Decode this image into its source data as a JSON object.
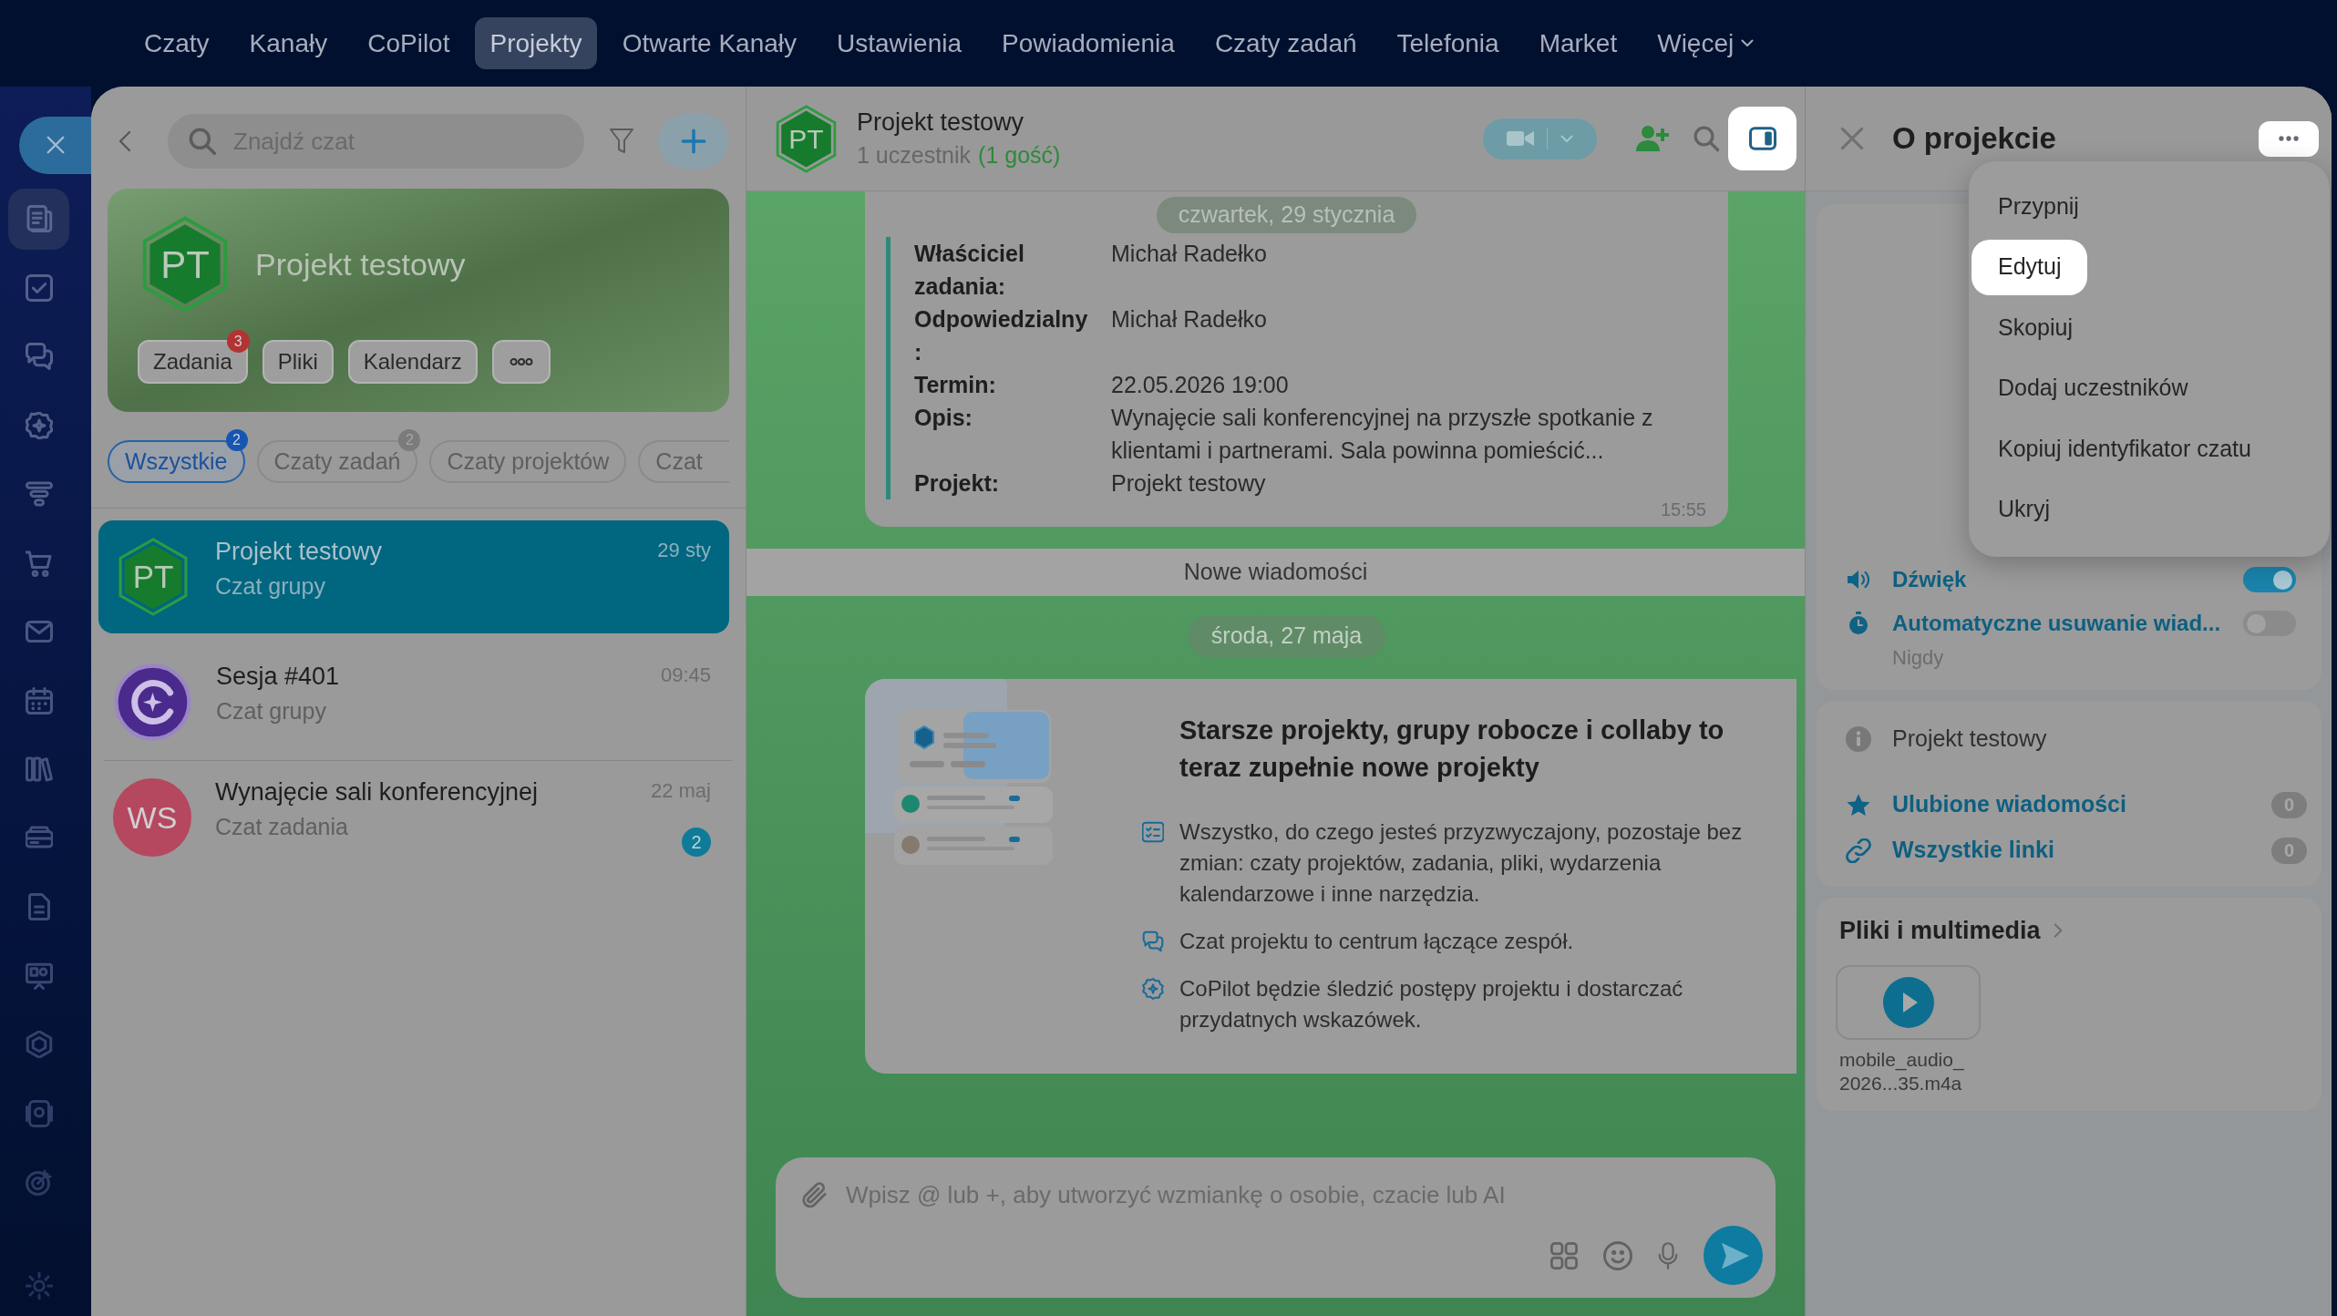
{
  "top_nav": {
    "items": [
      {
        "label": "Czaty",
        "selected": false,
        "kind": "link"
      },
      {
        "label": "Kanały",
        "selected": false,
        "kind": "link"
      },
      {
        "label": "CoPilot",
        "selected": false,
        "kind": "link"
      },
      {
        "label": "Projekty",
        "selected": true,
        "kind": "link"
      },
      {
        "label": "Otwarte Kanały",
        "selected": false,
        "kind": "link"
      },
      {
        "label": "Ustawienia",
        "selected": false,
        "kind": "link"
      },
      {
        "label": "Powiadomienia",
        "selected": false,
        "kind": "link"
      },
      {
        "label": "Czaty zadań",
        "selected": false,
        "kind": "link"
      },
      {
        "label": "Telefonia",
        "selected": false,
        "kind": "link"
      },
      {
        "label": "Market",
        "selected": false,
        "kind": "link"
      },
      {
        "label": "Więcej",
        "selected": false,
        "kind": "menu"
      }
    ]
  },
  "rail": {
    "items": [
      {
        "selected": true
      },
      {
        "selected": false
      },
      {
        "selected": false
      },
      {
        "selected": false
      },
      {
        "selected": false
      },
      {
        "selected": false
      },
      {
        "selected": false
      },
      {
        "selected": false
      },
      {
        "selected": false
      },
      {
        "selected": false
      },
      {
        "selected": false
      },
      {
        "selected": false
      },
      {
        "selected": false
      },
      {
        "selected": false
      },
      {
        "selected": false
      },
      {
        "selected": false
      }
    ]
  },
  "chat_list": {
    "search": {
      "placeholder": "Znajdź czat"
    },
    "project_card": {
      "avatar": "PT",
      "title": "Projekt testowy",
      "buttons": [
        {
          "kind": "text",
          "label": "Zadania",
          "badge": "3"
        },
        {
          "kind": "text",
          "label": "Pliki"
        },
        {
          "kind": "text",
          "label": "Kalendarz"
        },
        {
          "kind": "more"
        }
      ]
    },
    "filters": [
      {
        "label": "Wszystkie",
        "selected": true,
        "badge": "2"
      },
      {
        "label": "Czaty zadań",
        "selected": false,
        "badge": "2"
      },
      {
        "label": "Czaty projektów",
        "selected": false
      },
      {
        "label": "Czat",
        "selected": false
      }
    ],
    "chats": [
      {
        "kind": "project",
        "avatar": "PT",
        "title": "Projekt testowy",
        "subtitle": "Czat grupy",
        "time": "29 sty",
        "selected": true
      },
      {
        "kind": "copilot",
        "title": "Sesja #401",
        "subtitle": "Czat grupy",
        "time": "09:45",
        "selected": false
      },
      {
        "kind": "initials",
        "avatar": "WS",
        "color": "#b5475f",
        "title": "Wynajęcie sali konferencyjnej",
        "subtitle": "Czat zadania",
        "time": "22 maj",
        "unread": "2",
        "selected": false
      }
    ]
  },
  "chat": {
    "header": {
      "avatar": "PT",
      "title": "Projekt testowy",
      "members": "1 uczestnik",
      "guests": "(1 gość)",
      "panel_button": {
        "highlighted": true
      }
    },
    "sticky_date": "czwartek, 29 stycznia",
    "task_message": {
      "fields": [
        {
          "label": "Właściciel zadania:",
          "value": "Michał Radełko"
        },
        {
          "label": "Odpowiedzialny:",
          "value": "Michał Radełko"
        },
        {
          "label": "Termin:",
          "value": "22.05.2026 19:00"
        },
        {
          "label": "Opis:",
          "value": "Wynajęcie sali konferencyjnej na przyszłe spotkanie z klientami i partnerami. Sala powinna pomieścić..."
        },
        {
          "label": "Projekt:",
          "value": "Projekt testowy"
        }
      ],
      "time": "15:55"
    },
    "new_messages": "Nowe wiadomości",
    "date_separator": "środa, 27 maja",
    "promo": {
      "title": "Starsze projekty, grupy robocze i collaby to teraz zupełnie nowe projekty",
      "points": [
        "Wszystko, do czego jesteś przyzwyczajony, pozostaje bez zmian: czaty projektów, zadania, pliki, wydarzenia kalendarzowe i inne narzędzia.",
        "Czat projektu to centrum łączące zespół.",
        "CoPilot będzie śledzić postępy projektu i dostarczać przydatnych wskazówek."
      ]
    },
    "composer": {
      "placeholder": "Wpisz @ lub +, aby utworzyć wzmiankę o osobie, czacie lub AI"
    }
  },
  "details": {
    "title": "O projekcie",
    "more_button": {
      "highlighted": true
    },
    "menu": {
      "items": [
        {
          "label": "Przypnij",
          "highlighted": false
        },
        {
          "label": "Edytuj",
          "highlighted": true
        },
        {
          "label": "Skopiuj",
          "highlighted": false
        },
        {
          "label": "Dodaj uczestników",
          "highlighted": false
        },
        {
          "label": "Kopiuj identyfikator czatu",
          "highlighted": false
        },
        {
          "label": "Ukryj",
          "highlighted": false
        }
      ]
    },
    "settings": [
      {
        "label": "Dźwięk",
        "on": true
      },
      {
        "label": "Automatyczne usuwanie wiad...",
        "on": false,
        "value": "Nigdy"
      }
    ],
    "info": {
      "name": "Projekt testowy"
    },
    "links": [
      {
        "label": "Ulubione wiadomości",
        "count": "0"
      },
      {
        "label": "Wszystkie linki",
        "count": "0"
      }
    ],
    "media": {
      "title": "Pliki i multimedia",
      "files": [
        {
          "name": "mobile_audio_2026...35.m4a"
        }
      ]
    }
  }
}
